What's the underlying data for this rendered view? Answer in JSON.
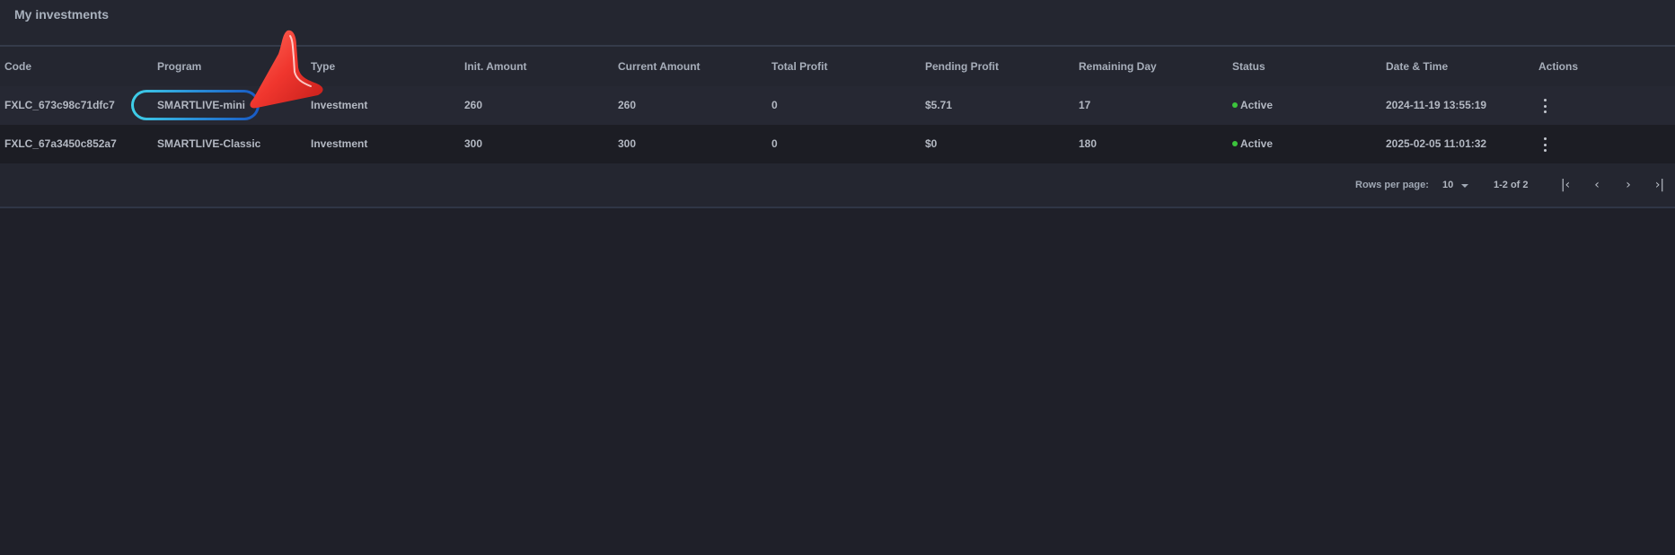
{
  "panel": {
    "title": "My investments"
  },
  "table": {
    "columns": [
      "Code",
      "Program",
      "Type",
      "Init. Amount",
      "Current Amount",
      "Total Profit",
      "Pending Profit",
      "Remaining Day",
      "Status",
      "Date & Time",
      "Actions"
    ],
    "rows": [
      {
        "code": "FXLC_673c98c71dfc7",
        "program": "SMARTLIVE-mini",
        "type": "Investment",
        "init_amount": "260",
        "current_amount": "260",
        "total_profit": "0",
        "pending_profit": "$5.71",
        "remaining_day": "17",
        "status": "Active",
        "datetime": "2024-11-19 13:55:19",
        "actions_icon": "more-vertical-icon"
      },
      {
        "code": "FXLC_67a3450c852a7",
        "program": "SMARTLIVE-Classic",
        "type": "Investment",
        "init_amount": "300",
        "current_amount": "300",
        "total_profit": "0",
        "pending_profit": "$0",
        "remaining_day": "180",
        "status": "Active",
        "datetime": "2025-02-05 11:01:32",
        "actions_icon": "more-vertical-icon"
      }
    ]
  },
  "pagination": {
    "rows_per_page_label": "Rows per page:",
    "rows_per_page_value": "10",
    "range_label": "1-2 of 2",
    "first_icon": "first-page-icon",
    "prev_icon": "chevron-left-icon",
    "next_icon": "chevron-right-icon",
    "last_icon": "last-page-icon"
  },
  "colors": {
    "background": "#1f2029",
    "panel": "#242630",
    "status_active": "#3cc43c",
    "highlight_ring_start": "#3fd0e8",
    "highlight_ring_end": "#1859c4",
    "pointer": "#f0362e"
  }
}
